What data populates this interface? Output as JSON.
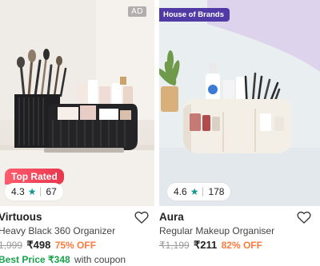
{
  "products": [
    {
      "ad_badge": "AD",
      "tag": "Top Rated",
      "rating": "4.3",
      "rating_count": "67",
      "brand": "Virtuous",
      "name": "Heavy Black 360 Organizer",
      "mrp": "1,999",
      "price": "₹498",
      "discount": "75% OFF",
      "best_price_label": "Best Price ₹348",
      "coupon_text": "with coupon"
    },
    {
      "badge": "House of Brands",
      "rating": "4.6",
      "rating_count": "178",
      "brand": "Aura",
      "name": "Regular Makeup Organiser",
      "mrp": "₹1,199",
      "price": "₹211",
      "discount": "82% OFF"
    }
  ],
  "colors": {
    "star": "#14958f",
    "discount": "#ff7a3d",
    "best_price": "#16a34a",
    "brand_badge": "#4f3aa6",
    "top_rated": "#e8374d"
  },
  "icons": {
    "rating": "star-icon",
    "wishlist": "heart-icon"
  }
}
